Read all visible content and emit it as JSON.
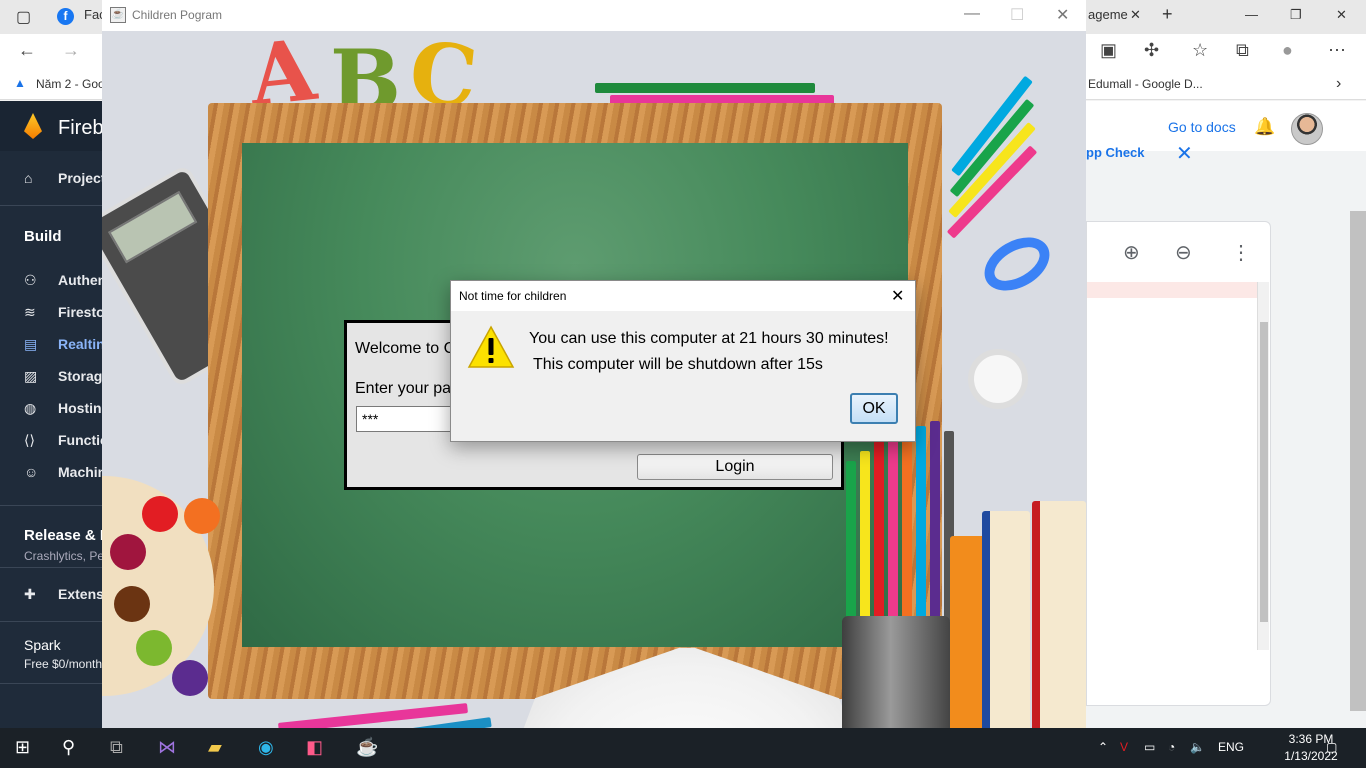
{
  "browser": {
    "tab_left_label": "Fac",
    "tab_right_label": "ageme",
    "bookmark_left": "Năm 2 - Goo",
    "bookmark_right": "Edumall - Google D..."
  },
  "firebase": {
    "brand": "Fireb",
    "items": [
      {
        "label": "Project",
        "icon": "home-icon"
      },
      {
        "label": "Authen",
        "icon": "people-icon"
      },
      {
        "label": "Firesto",
        "icon": "firestore-icon"
      },
      {
        "label": "Realtin",
        "icon": "database-icon"
      },
      {
        "label": "Storag",
        "icon": "image-icon"
      },
      {
        "label": "Hostin",
        "icon": "globe-icon"
      },
      {
        "label": "Functio",
        "icon": "functions-icon"
      },
      {
        "label": "Machin",
        "icon": "robot-icon"
      },
      {
        "label": "Extens",
        "icon": "extension-icon"
      }
    ],
    "build_label": "Build",
    "release_label": "Release & M",
    "release_sub": "Crashlytics, Pe",
    "spark_label": "Spark",
    "spark_sub": "Free $0/month",
    "goto_docs": "Go to docs",
    "app_check": "pp Check"
  },
  "app": {
    "window_title": "Children Pogram",
    "abc": [
      "A",
      "B",
      "C"
    ],
    "welcome": "Welcome to C",
    "enter_password": "Enter your pa",
    "password_value": "***",
    "login_button": "Login"
  },
  "dialog": {
    "title": "Not time for children",
    "message_line1": "You can use this computer at 21 hours 30 minutes!",
    "message_line2": "This computer will be shutdown after 15s",
    "ok_button": "OK",
    "icon": "warning-icon"
  },
  "taskbar": {
    "language": "ENG",
    "time": "3:36 PM",
    "date": "1/13/2022"
  },
  "colors": {
    "board": "#468a5b",
    "frame": "#c98a45",
    "dialog_ok_border": "#3c7fb1",
    "firebase_sidebar": "#1f2b3a",
    "accent": "#1a73e8"
  }
}
